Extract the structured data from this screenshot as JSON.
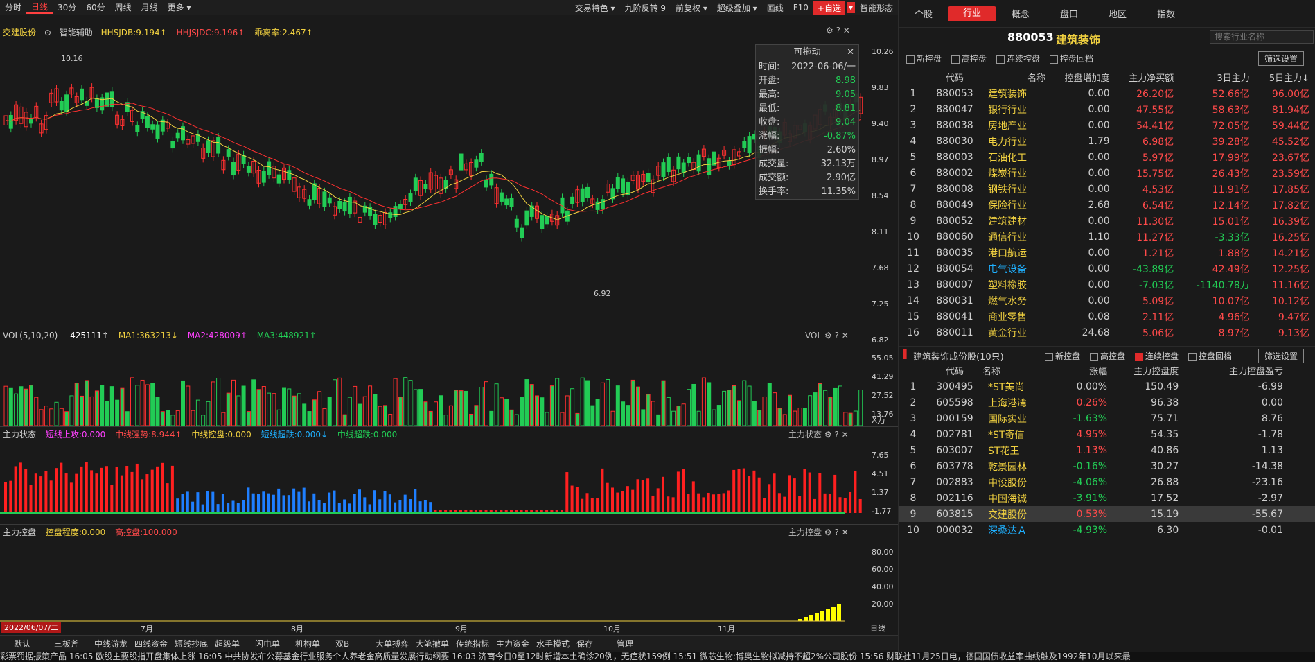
{
  "toolbar": {
    "periods": [
      "分时",
      "日线",
      "30分",
      "60分",
      "周线",
      "月线",
      "更多 ▾"
    ],
    "active_period": "日线",
    "right_items": [
      "交易特色 ▾",
      "九阶反转 9",
      "前复权 ▾",
      "超级叠加 ▾",
      "画线",
      "F10"
    ],
    "add_fav": "+自选",
    "smart": "智能形态"
  },
  "main_legend": {
    "stock": "交建股份",
    "assist": "智能辅助",
    "hhsjdb": "HHSJDB:9.194↑",
    "hhsjdc": "HHJSJDC:9.196↑",
    "rate": "乖离率:2.467↑"
  },
  "price_axis": [
    "10.26",
    "9.83",
    "9.40",
    "8.97",
    "8.54",
    "8.11",
    "7.68",
    "7.25",
    "6.82"
  ],
  "price_marks": {
    "high": "10.16",
    "low": "6.92"
  },
  "tooltip": {
    "title": "可拖动",
    "rows": [
      {
        "k": "时间:",
        "v": "2022-06-06/一",
        "c": "#cfcfcf"
      },
      {
        "k": "开盘:",
        "v": "8.98",
        "c": "#22cc55"
      },
      {
        "k": "最高:",
        "v": "9.05",
        "c": "#22cc55"
      },
      {
        "k": "最低:",
        "v": "8.81",
        "c": "#22cc55"
      },
      {
        "k": "收盘:",
        "v": "9.04",
        "c": "#22cc55"
      },
      {
        "k": "涨幅:",
        "v": "-0.87%",
        "c": "#22cc55"
      },
      {
        "k": "振幅:",
        "v": "2.60%",
        "c": "#cfcfcf"
      },
      {
        "k": "成交量:",
        "v": "32.13万",
        "c": "#cfcfcf"
      },
      {
        "k": "成交额:",
        "v": "2.90亿",
        "c": "#cfcfcf"
      },
      {
        "k": "换手率:",
        "v": "11.35%",
        "c": "#cfcfcf"
      }
    ]
  },
  "vol_panel": {
    "title": "VOL(5,10,20)",
    "vol": "425111↑",
    "ma1": "MA1:363213↓",
    "ma2": "MA2:428009↑",
    "ma3": "MA3:448921↑",
    "name": "VOL",
    "axis": [
      "55.05",
      "41.29",
      "27.52",
      "13.76"
    ],
    "unit": "X万"
  },
  "state_panel": {
    "title": "主力状态",
    "s1": "短线上攻:0.000",
    "s2": "中线强势:8.944↑",
    "s3": "中线控盘:0.000",
    "s4": "短线超跌:0.000↓",
    "s5": "中线超跌:0.000",
    "name": "主力状态",
    "axis": [
      "7.65",
      "4.51",
      "1.37",
      "-1.77"
    ]
  },
  "control_panel": {
    "title": "主力控盘",
    "c1": "控盘程度:0.000",
    "c2": "高控盘:100.000",
    "name": "主力控盘",
    "axis": [
      "80.00",
      "60.00",
      "40.00",
      "20.00"
    ]
  },
  "date_axis": {
    "current": "2022/06/07/二",
    "months": [
      "7月",
      "8月",
      "9月",
      "10月",
      "11月"
    ],
    "period": "日线"
  },
  "bottom_tabs": [
    "默认",
    "三板斧",
    "中线游龙",
    "四线资金",
    "短线抄底",
    "超级单",
    "闪电单",
    "机构单",
    "双B",
    "大单搏弈",
    "大笔撤单",
    "传统指标",
    "主力资金",
    "水手模式",
    "保存",
    "管理"
  ],
  "news": "彩票罚据振策产品   16:05 欧股主要股指开盘集体上涨   16:05 中共协发布公募基金行业服务个人养老金高质量发展行动纲要   16:03 济南今日0至12时新增本土确诊20例，无症状159例   15:51 微芯生物:博奥生物拟减持不超2%公司股份   15:56 财联社11月25日电，德国国债收益率曲线触及1992年10月以来最",
  "right": {
    "tabs": [
      "个股",
      "行业",
      "概念",
      "盘口",
      "地区",
      "指数"
    ],
    "active_tab": "行业",
    "code": "880053",
    "name": "建筑装饰",
    "search_placeholder": "搜索行业名称",
    "filters": [
      "新控盘",
      "高控盘",
      "连续控盘",
      "控盘回档"
    ],
    "filter_btn": "筛选设置",
    "headers": [
      "代码",
      "名称",
      "控盘增加度",
      "主力净买额",
      "3日主力",
      "5日主力↓"
    ],
    "rows": [
      [
        "1",
        "880053",
        "建筑装饰",
        "0.00",
        "26.20亿",
        "52.66亿",
        "96.00亿"
      ],
      [
        "2",
        "880047",
        "银行行业",
        "0.00",
        "47.55亿",
        "58.63亿",
        "81.94亿"
      ],
      [
        "3",
        "880038",
        "房地产业",
        "0.00",
        "54.41亿",
        "72.05亿",
        "59.44亿"
      ],
      [
        "4",
        "880030",
        "电力行业",
        "1.79",
        "6.98亿",
        "39.28亿",
        "45.52亿"
      ],
      [
        "5",
        "880003",
        "石油化工",
        "0.00",
        "5.97亿",
        "17.99亿",
        "23.67亿"
      ],
      [
        "6",
        "880002",
        "煤炭行业",
        "0.00",
        "15.75亿",
        "26.43亿",
        "23.59亿"
      ],
      [
        "7",
        "880008",
        "钢铁行业",
        "0.00",
        "4.53亿",
        "11.91亿",
        "17.85亿"
      ],
      [
        "8",
        "880049",
        "保险行业",
        "2.68",
        "6.54亿",
        "12.14亿",
        "17.82亿"
      ],
      [
        "9",
        "880052",
        "建筑建材",
        "0.00",
        "11.30亿",
        "15.01亿",
        "16.39亿"
      ],
      [
        "10",
        "880060",
        "通信行业",
        "1.10",
        "11.27亿",
        "-3.33亿",
        "16.25亿"
      ],
      [
        "11",
        "880035",
        "港口航运",
        "0.00",
        "1.21亿",
        "1.88亿",
        "14.21亿"
      ],
      [
        "12",
        "880054",
        "电气设备",
        "0.00",
        "-43.89亿",
        "42.49亿",
        "12.25亿"
      ],
      [
        "13",
        "880007",
        "塑料橡胶",
        "0.00",
        "-7.03亿",
        "-1140.78万",
        "11.16亿"
      ],
      [
        "14",
        "880031",
        "燃气水务",
        "0.00",
        "5.09亿",
        "10.07亿",
        "10.12亿"
      ],
      [
        "15",
        "880041",
        "商业零售",
        "0.08",
        "2.11亿",
        "4.96亿",
        "9.47亿"
      ],
      [
        "16",
        "880011",
        "黄金行业",
        "24.68",
        "5.06亿",
        "8.97亿",
        "9.13亿"
      ]
    ],
    "sub_title": "建筑装饰成份股(10只)",
    "sub_filters": [
      "新控盘",
      "高控盘",
      "连续控盘",
      "控盘回档"
    ],
    "sub_headers": [
      "代码",
      "名称",
      "涨幅",
      "主力控盘度",
      "主力控盘盈亏"
    ],
    "sub_rows": [
      [
        "1",
        "300495",
        "*ST美尚",
        "0.00%",
        "150.49",
        "-6.99"
      ],
      [
        "2",
        "605598",
        "上海港湾",
        "0.26%",
        "96.38",
        "0.00"
      ],
      [
        "3",
        "000159",
        "国际实业",
        "-1.63%",
        "75.71",
        "8.76"
      ],
      [
        "4",
        "002781",
        "*ST奇信",
        "4.95%",
        "54.35",
        "-1.78"
      ],
      [
        "5",
        "603007",
        "ST花王",
        "1.13%",
        "40.86",
        "1.13"
      ],
      [
        "6",
        "603778",
        "乾景园林",
        "-0.16%",
        "30.27",
        "-14.38"
      ],
      [
        "7",
        "002883",
        "中设股份",
        "-4.06%",
        "26.88",
        "-23.16"
      ],
      [
        "8",
        "002116",
        "中国海诚",
        "-3.91%",
        "17.52",
        "-2.97"
      ],
      [
        "9",
        "603815",
        "交建股份",
        "0.53%",
        "15.19",
        "-55.67"
      ],
      [
        "10",
        "000032",
        "深桑达Ａ",
        "-4.93%",
        "6.30",
        "-0.01"
      ]
    ]
  }
}
